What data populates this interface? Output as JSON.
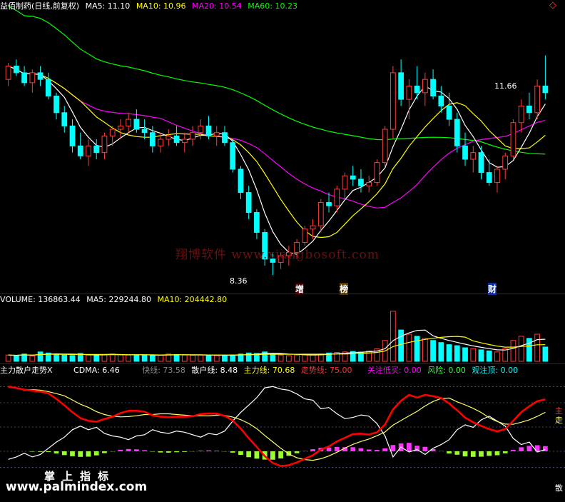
{
  "colors": {
    "up": "#ff3c3c",
    "down": "#00ffff",
    "ma5": "#ffffff",
    "ma10": "#ffff00",
    "ma20": "#ff00ff",
    "ma60": "#00ff00",
    "zl_line": "#ff0000",
    "trend_line": "#ffff66",
    "sanhu": "#ffffff",
    "kuai": "#888888",
    "bar_pos": "#ff0000",
    "bar_neg": "#99ff33",
    "bar_mid": "#ff33ff",
    "vol_up": "#ff3c3c",
    "vol_down": "#00ffff"
  },
  "price_panel": {
    "title": "益佰制药(日线,前复权)",
    "ma5": "MA5: 11.10",
    "ma10": "MA10: 10.96",
    "ma20": "MA20: 10.54",
    "ma60": "MA60: 10.23",
    "high_label": "11.66",
    "low_label": "8.36",
    "tag_zeng": "增",
    "tag_bang": "榜",
    "tag_cai": "财",
    "watermark": "翔博软件 www.xiangbosoft.com",
    "top_right_icon": "diamond-icon"
  },
  "volume_panel": {
    "volume": "VOLUME: 136863.44",
    "ma5": "MA5: 229244.80",
    "ma10": "MA10: 204442.80"
  },
  "indicator_panel": {
    "name": "主力散户走势X",
    "cdma": "CDMA: 6.46",
    "kuai": "快线: 73.58",
    "sanhu": "散户线: 8.48",
    "zhuli": "主力线: 70.68",
    "zoushi": "走势线: 75.00",
    "guanzhu": "关注低买: 0.00",
    "fengxian": "风险: 0.00",
    "guanzhuding": "观注顶: 0.00",
    "right_labels": [
      "主",
      "走",
      "散"
    ],
    "watermark_palm": "www.palmindex.com",
    "watermark_cn": "掌上指标"
  },
  "chart_data": {
    "type": "candlestick",
    "price_range": [
      8.2,
      12.3
    ],
    "candles": [
      [
        11.3,
        11.55,
        11.2,
        11.5
      ],
      [
        11.5,
        11.6,
        11.35,
        11.4
      ],
      [
        11.4,
        11.5,
        11.2,
        11.25
      ],
      [
        11.25,
        11.45,
        11.1,
        11.4
      ],
      [
        11.4,
        11.5,
        11.2,
        11.3
      ],
      [
        11.3,
        11.4,
        11.0,
        11.05
      ],
      [
        11.05,
        11.1,
        10.7,
        10.8
      ],
      [
        10.8,
        10.9,
        10.5,
        10.6
      ],
      [
        10.6,
        10.7,
        10.2,
        10.3
      ],
      [
        10.3,
        10.5,
        10.1,
        10.15
      ],
      [
        10.15,
        10.4,
        10.0,
        10.3
      ],
      [
        10.3,
        10.4,
        10.1,
        10.2
      ],
      [
        10.2,
        10.5,
        10.1,
        10.45
      ],
      [
        10.45,
        10.6,
        10.3,
        10.55
      ],
      [
        10.55,
        10.7,
        10.4,
        10.6
      ],
      [
        10.6,
        10.8,
        10.5,
        10.7
      ],
      [
        10.7,
        10.85,
        10.5,
        10.55
      ],
      [
        10.55,
        10.7,
        10.4,
        10.5
      ],
      [
        10.5,
        10.6,
        10.2,
        10.3
      ],
      [
        10.3,
        10.5,
        10.2,
        10.4
      ],
      [
        10.4,
        10.55,
        10.3,
        10.45
      ],
      [
        10.45,
        10.6,
        10.3,
        10.35
      ],
      [
        10.35,
        10.5,
        10.2,
        10.4
      ],
      [
        10.4,
        10.6,
        10.3,
        10.5
      ],
      [
        10.5,
        10.7,
        10.4,
        10.6
      ],
      [
        10.6,
        10.75,
        10.4,
        10.45
      ],
      [
        10.45,
        10.6,
        10.3,
        10.5
      ],
      [
        10.5,
        10.6,
        10.3,
        10.35
      ],
      [
        10.35,
        10.4,
        9.9,
        9.95
      ],
      [
        9.95,
        10.0,
        9.5,
        9.6
      ],
      [
        9.6,
        9.7,
        9.2,
        9.3
      ],
      [
        9.3,
        9.35,
        8.9,
        9.0
      ],
      [
        9.0,
        9.05,
        8.5,
        8.6
      ],
      [
        8.6,
        8.7,
        8.36,
        8.55
      ],
      [
        8.55,
        8.7,
        8.45,
        8.65
      ],
      [
        8.65,
        8.8,
        8.5,
        8.7
      ],
      [
        8.7,
        8.9,
        8.6,
        8.85
      ],
      [
        8.85,
        9.1,
        8.8,
        9.05
      ],
      [
        9.05,
        9.2,
        8.9,
        9.1
      ],
      [
        9.1,
        9.5,
        9.0,
        9.45
      ],
      [
        9.45,
        9.6,
        9.3,
        9.4
      ],
      [
        9.4,
        9.7,
        9.3,
        9.65
      ],
      [
        9.65,
        9.9,
        9.5,
        9.85
      ],
      [
        9.85,
        10.0,
        9.7,
        9.8
      ],
      [
        9.8,
        9.95,
        9.6,
        9.7
      ],
      [
        9.7,
        9.85,
        9.6,
        9.75
      ],
      [
        9.75,
        10.1,
        9.7,
        10.05
      ],
      [
        10.05,
        10.6,
        10.0,
        10.55
      ],
      [
        10.55,
        11.5,
        10.4,
        11.4
      ],
      [
        11.4,
        11.6,
        10.9,
        11.0
      ],
      [
        11.0,
        11.3,
        10.7,
        11.2
      ],
      [
        11.2,
        11.5,
        11.0,
        11.1
      ],
      [
        11.1,
        11.4,
        10.9,
        11.3
      ],
      [
        11.3,
        11.45,
        11.0,
        11.05
      ],
      [
        11.05,
        11.2,
        10.8,
        10.9
      ],
      [
        10.9,
        11.1,
        10.6,
        10.7
      ],
      [
        10.7,
        10.8,
        10.2,
        10.3
      ],
      [
        10.3,
        10.5,
        10.0,
        10.1
      ],
      [
        10.1,
        10.3,
        9.9,
        10.2
      ],
      [
        10.2,
        10.3,
        9.8,
        9.9
      ],
      [
        9.9,
        10.1,
        9.7,
        9.75
      ],
      [
        9.75,
        10.0,
        9.6,
        9.95
      ],
      [
        9.95,
        10.2,
        9.8,
        10.15
      ],
      [
        10.15,
        10.7,
        10.1,
        10.65
      ],
      [
        10.65,
        11.0,
        10.5,
        10.9
      ],
      [
        10.9,
        11.1,
        10.7,
        10.8
      ],
      [
        10.8,
        11.3,
        10.7,
        11.2
      ],
      [
        11.2,
        11.66,
        11.0,
        11.1
      ]
    ],
    "volume_range": [
      0,
      520000
    ],
    "volumes": [
      60000,
      55000,
      70000,
      50000,
      90000,
      80000,
      65000,
      60000,
      55000,
      75000,
      60000,
      58000,
      62000,
      70000,
      65000,
      60000,
      58000,
      62000,
      55000,
      60000,
      70000,
      65000,
      60000,
      58000,
      62000,
      60000,
      55000,
      58000,
      60000,
      70000,
      80000,
      75000,
      90000,
      70000,
      60000,
      55000,
      60000,
      65000,
      62000,
      70000,
      80000,
      85000,
      90000,
      95000,
      88000,
      100000,
      120000,
      200000,
      480000,
      300000,
      260000,
      240000,
      220000,
      200000,
      180000,
      160000,
      150000,
      130000,
      120000,
      110000,
      100000,
      90000,
      120000,
      200000,
      240000,
      220000,
      260000,
      137000
    ],
    "indicator_range": [
      -40,
      110
    ]
  }
}
